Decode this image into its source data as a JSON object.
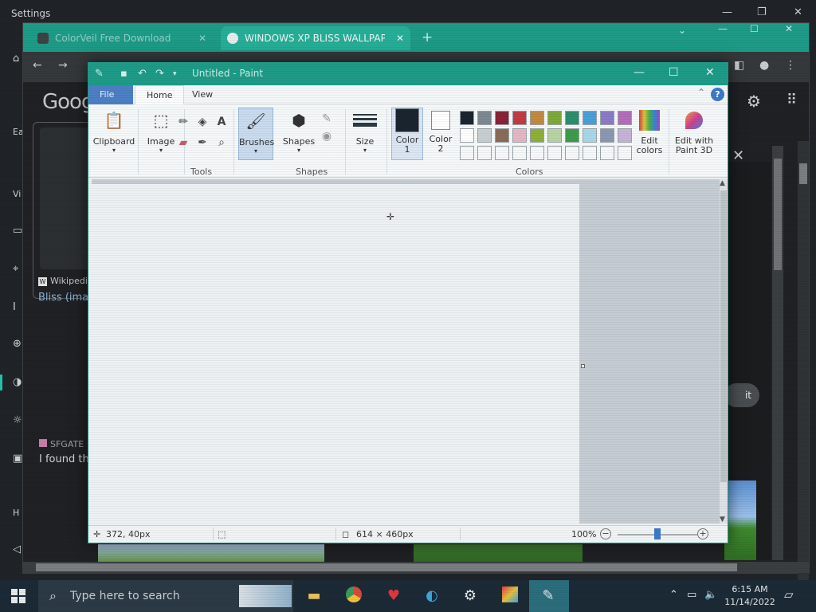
{
  "settings": {
    "title": "Settings",
    "side_letters": [
      "Ea",
      "Vi",
      "H"
    ]
  },
  "chrome": {
    "tabs": [
      {
        "label": "ColorVeil Free Download",
        "favicon_color": "#4c4c4c"
      },
      {
        "label": "WINDOWS XP BLISS WALLPAPER",
        "favicon_color": "#e9ecef"
      }
    ],
    "new_tab_glyph": "+",
    "google_logo": "Goog",
    "result": {
      "source": "Wikipedi",
      "title": "Bliss (ima"
    },
    "sfgate": {
      "source": "SFGATE",
      "snippet": "I found th"
    },
    "submit_fragment": "it",
    "close_glyph": "✕"
  },
  "paint": {
    "title": "Untitled - Paint",
    "tabs": {
      "file": "File",
      "home": "Home",
      "view": "View"
    },
    "help": "?",
    "groups": {
      "clipboard": "Clipboard",
      "image": "Image",
      "tools": "Tools",
      "brushes": "Brushes",
      "shapes_btn": "Shapes",
      "shapes": "Shapes",
      "size": "Size",
      "color1": "Color\n1",
      "color1_a": "Color",
      "color1_b": "1",
      "color2_a": "Color",
      "color2_b": "2",
      "edit_colors_a": "Edit",
      "edit_colors_b": "colors",
      "edit_paint3d_a": "Edit with",
      "edit_paint3d_b": "Paint 3D",
      "colors": "Colors"
    },
    "color1_value": "#1a2530",
    "color2_value": "#ffffff",
    "palette_row1": [
      "#1a2530",
      "#7d8890",
      "#8a2336",
      "#c43a45",
      "#c28a3c",
      "#7ea93a",
      "#2b8f6c",
      "#4aa0d8",
      "#8b7ac8",
      "#b46dbb"
    ],
    "palette_row2": [
      "#ffffff",
      "#c9ced1",
      "#8a6b58",
      "#e5b7c5",
      "#8faf3a",
      "#b8d4a3",
      "#3e9c4b",
      "#a9d8ea",
      "#8b98b2",
      "#c8b3d8"
    ],
    "status": {
      "cursor_pos": "372, 40px",
      "image_size": "614 × 460px",
      "zoom": "100%",
      "zoom_fraction": 0.5
    }
  },
  "taskbar": {
    "search_placeholder": "Type here to search",
    "time": "6:15 AM",
    "date": "11/14/2022"
  }
}
